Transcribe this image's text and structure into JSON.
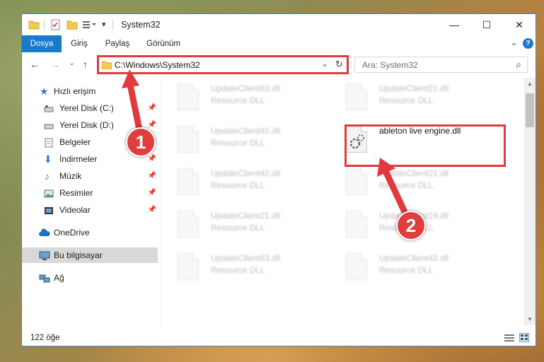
{
  "window": {
    "title": "System32",
    "controls": {
      "minimize": "—",
      "maximize": "☐",
      "close": "✕"
    }
  },
  "ribbon": {
    "tabs": [
      "Dosya",
      "Giriş",
      "Paylaş",
      "Görünüm"
    ],
    "expand_icon": "chevron-down-icon",
    "help_icon": "help-icon",
    "help_label": "?",
    "expand_label": "⌄"
  },
  "navigation": {
    "back": "←",
    "forward": "→",
    "recent": "⌄",
    "up": "↑",
    "address": "C:\\Windows\\System32",
    "address_dropdown": "⌄",
    "refresh": "↻",
    "search_placeholder": "Ara: System32",
    "search_icon": "⌕"
  },
  "sidebar": {
    "items": [
      {
        "label": "Hızlı erişim",
        "icon": "star-icon",
        "pinned": false
      },
      {
        "label": "Yerel Disk (C:)",
        "icon": "drive-icon",
        "pinned": true
      },
      {
        "label": "Yerel Disk (D:)",
        "icon": "drive-icon",
        "pinned": true
      },
      {
        "label": "Belgeler",
        "icon": "documents-icon",
        "pinned": true
      },
      {
        "label": "İndirmeler",
        "icon": "download-icon",
        "pinned": true
      },
      {
        "label": "Müzik",
        "icon": "music-icon",
        "pinned": true
      },
      {
        "label": "Resimler",
        "icon": "pictures-icon",
        "pinned": true
      },
      {
        "label": "Videolar",
        "icon": "videos-icon",
        "pinned": true
      },
      {
        "label": "OneDrive",
        "icon": "cloud-icon",
        "pinned": false
      },
      {
        "label": "Bu bilgisayar",
        "icon": "computer-icon",
        "pinned": false,
        "selected": true
      },
      {
        "label": "Ağ",
        "icon": "network-icon",
        "pinned": false
      }
    ],
    "pin_glyph": "📌"
  },
  "files": [
    {
      "name": "UpdateClient63.dll",
      "desc": "Resource DLL",
      "highlight": false
    },
    {
      "name": "UpdateClient21.dll",
      "desc": "Resource DLL",
      "highlight": false
    },
    {
      "name": "UpdateClient42.dll",
      "desc": "Resource DLL",
      "highlight": false
    },
    {
      "name": "ableton live engine.dll",
      "desc": "",
      "highlight": true
    },
    {
      "name": "UpdateClient42.dll",
      "desc": "Resource DLL",
      "highlight": false
    },
    {
      "name": "UpdateClient21.dll",
      "desc": "Resource DLL",
      "highlight": false
    },
    {
      "name": "UpdateClient21.dll",
      "desc": "Resource DLL",
      "highlight": false
    },
    {
      "name": "UpdateClient19.dll",
      "desc": "Resource DLL",
      "highlight": false
    },
    {
      "name": "UpdateClient63.dll",
      "desc": "Resource DLL",
      "highlight": false
    },
    {
      "name": "UpdateClient42.dll",
      "desc": "Resource DLL",
      "highlight": false
    }
  ],
  "status": {
    "item_count": "122 öğe"
  },
  "annotations": {
    "marker_1": "1",
    "marker_2": "2",
    "color": "#e0393e"
  },
  "colors": {
    "file_tab": "#1979ca",
    "accent": "#3f84d6"
  }
}
